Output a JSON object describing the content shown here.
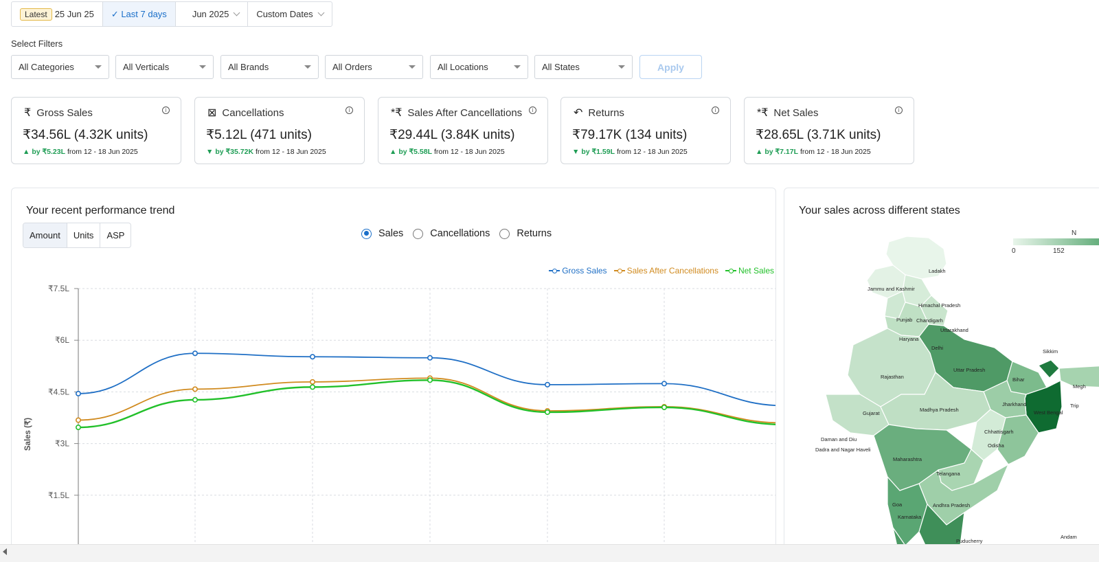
{
  "datebar": {
    "latest_tag": "Latest",
    "latest_date": "25 Jun 25",
    "last7": "✓ Last 7 days",
    "month": "Jun 2025",
    "custom": "Custom Dates"
  },
  "filters": {
    "label": "Select Filters",
    "items": [
      "All Categories",
      "All Verticals",
      "All Brands",
      "All Orders",
      "All Locations",
      "All States"
    ],
    "apply": "Apply"
  },
  "cards": [
    {
      "icon": "₹",
      "title": "Gross Sales",
      "value": "₹34.56L (4.32K units)",
      "arrow": "▲",
      "delta": "by ₹5.23L",
      "from": "from 12 - 18 Jun 2025"
    },
    {
      "icon": "⊠",
      "title": "Cancellations",
      "value": "₹5.12L (471 units)",
      "arrow": "▼",
      "delta": "by ₹35.72K",
      "from": "from 12 - 18 Jun 2025"
    },
    {
      "icon": "*₹",
      "title": "Sales After Cancellations",
      "value": "₹29.44L (3.84K units)",
      "arrow": "▲",
      "delta": "by ₹5.58L",
      "from": "from 12 - 18 Jun 2025"
    },
    {
      "icon": "↶",
      "title": "Returns",
      "value": "₹79.17K (134 units)",
      "arrow": "▼",
      "delta": "by ₹1.59L",
      "from": "from 12 - 18 Jun 2025"
    },
    {
      "icon": "*₹",
      "title": "Net Sales",
      "value": "₹28.65L (3.71K units)",
      "arrow": "▲",
      "delta": "by ₹7.17L",
      "from": "from 12 - 18 Jun 2025"
    }
  ],
  "trend": {
    "title": "Your recent performance trend",
    "tabs": [
      "Amount",
      "Units",
      "ASP"
    ],
    "radios": [
      "Sales",
      "Cancellations",
      "Returns"
    ],
    "legend": [
      "Gross Sales",
      "Sales After Cancellations",
      "Net Sales"
    ]
  },
  "chart_data": {
    "type": "line",
    "ylabel": "Sales (₹)",
    "ytick_labels": [
      "₹7.5L",
      "₹6L",
      "₹4.5L",
      "₹3L",
      "₹1.5L"
    ],
    "ylim": [
      0,
      7.5
    ],
    "grid": true,
    "legend_position": "top-right",
    "series": [
      {
        "name": "Gross Sales",
        "color": "#1f6fc5",
        "values": [
          4.45,
          5.62,
          5.52,
          5.49,
          4.71,
          4.74,
          4.1
        ]
      },
      {
        "name": "Sales After Cancellations",
        "color": "#d08a1e",
        "values": [
          3.68,
          4.58,
          4.79,
          4.9,
          3.95,
          4.07,
          3.6
        ]
      },
      {
        "name": "Net Sales",
        "color": "#22c02a",
        "values": [
          3.47,
          4.27,
          4.64,
          4.84,
          3.91,
          4.05,
          3.55
        ]
      }
    ]
  },
  "map": {
    "title": "Your sales across different states",
    "legend_min": "0",
    "legend_mid": "152",
    "legend_cut": "N",
    "labels": [
      "Ladakh",
      "Jammu and Kashmir",
      "Himachal Pradesh",
      "Punjab",
      "Chandigarh",
      "Uttarakhand",
      "Haryana",
      "Delhi",
      "Uttar Pradesh",
      "Sikkim",
      "Rajasthan",
      "Bihar",
      "Megh",
      "Jharkhand",
      "Trip",
      "Gujarat",
      "Madhya Pradesh",
      "West Bengal",
      "Chhattisgarh",
      "Daman and Diu",
      "Dadra and Nagar Haveli",
      "Odisha",
      "Maharashtra",
      "Telangana",
      "Goa",
      "Andhra Pradesh",
      "Karnataka",
      "Puducherry",
      "Andam"
    ]
  }
}
